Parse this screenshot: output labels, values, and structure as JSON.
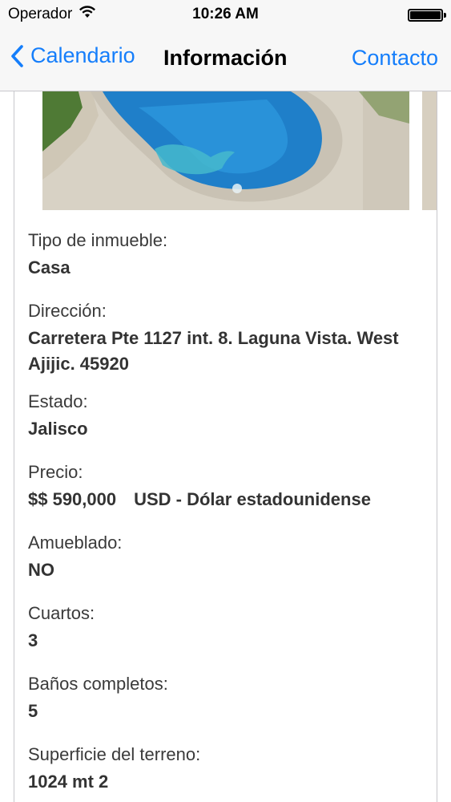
{
  "status_bar": {
    "carrier": "Operador",
    "time": "10:26 AM",
    "battery_level": 1.0
  },
  "nav": {
    "back_label": "Calendario",
    "title": "Información",
    "action_label": "Contacto"
  },
  "colors": {
    "accent": "#157efb",
    "bar_background": "#f7f7f7",
    "divider": "#c8c7cc"
  },
  "property": {
    "fields": [
      {
        "label": "Tipo de inmueble:",
        "value": "Casa"
      },
      {
        "label": "Dirección:",
        "value": "Carretera Pte 1127 int. 8. Laguna Vista. West Ajijic. 45920"
      },
      {
        "label": "Estado:",
        "value": "Jalisco"
      },
      {
        "label": "Precio:",
        "value": "$$ 590,000",
        "currency": "USD - Dólar estadounidense"
      },
      {
        "label": "Amueblado:",
        "value": "NO"
      },
      {
        "label": "Cuartos:",
        "value": "3"
      },
      {
        "label": "Baños completos:",
        "value": "5"
      },
      {
        "label": "Superficie del terreno:",
        "value": "1024 mt 2"
      }
    ]
  }
}
